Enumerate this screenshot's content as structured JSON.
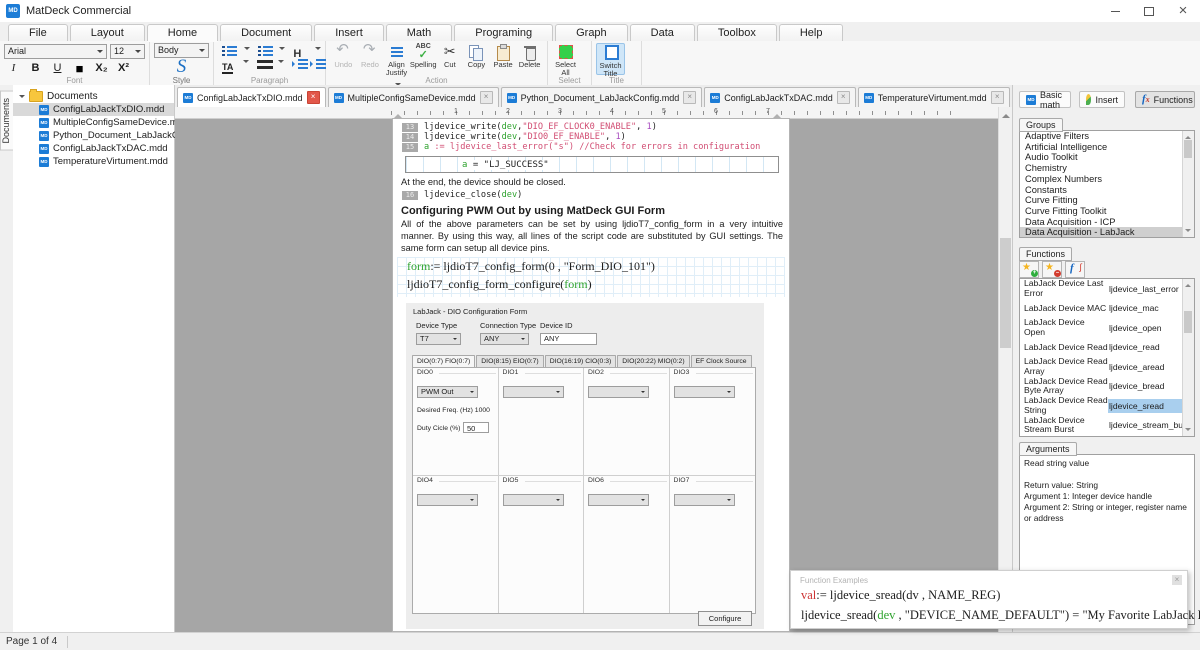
{
  "window": {
    "title": "MatDeck Commercial"
  },
  "ribbon": {
    "tabs": [
      "File",
      "Layout",
      "Home",
      "Document",
      "Insert",
      "Math",
      "Programing",
      "Graph",
      "Data",
      "Toolbox",
      "Help"
    ],
    "active_tab": "Home",
    "font": {
      "caption": "Font",
      "family": "Arial",
      "size": "12",
      "buttons": [
        "I",
        "B",
        "U",
        "■",
        "X₂",
        "X²"
      ]
    },
    "style": {
      "caption": "Style",
      "combo": "Body",
      "letter": "S",
      "label": "Style"
    },
    "paragraph": {
      "caption": "Paragraph"
    },
    "action": {
      "caption": "Action",
      "items": [
        {
          "label": "Undo",
          "icon": "undo",
          "disabled": true
        },
        {
          "label": "Redo",
          "icon": "redo",
          "disabled": true
        },
        {
          "label": "Align Justify",
          "icon": "align",
          "dropdown": true
        },
        {
          "label": "Spelling",
          "icon": "spelling"
        },
        {
          "label": "Cut",
          "icon": "cut"
        },
        {
          "label": "Copy",
          "icon": "copy"
        },
        {
          "label": "Paste",
          "icon": "paste"
        },
        {
          "label": "Delete",
          "icon": "delete"
        }
      ]
    },
    "select": {
      "caption": "Select",
      "items": [
        {
          "label": "Select All",
          "icon": "selectall"
        }
      ]
    },
    "title": {
      "caption": "Title",
      "items": [
        {
          "label": "Switch Title",
          "icon": "switchtitle",
          "active": true
        }
      ]
    }
  },
  "sidebar": {
    "strip_label": "Documents",
    "root_label": "Documents",
    "files": [
      "ConfigLabJackTxDIO.mdd",
      "MultipleConfigSameDevice.mdd",
      "Python_Document_LabJackConfi...",
      "ConfigLabJackTxDAC.mdd",
      "TemperatureVirtument.mdd"
    ],
    "selected_file": "ConfigLabJackTxDIO.mdd"
  },
  "doc_tabs": [
    {
      "label": "ConfigLabJackTxDIO.mdd",
      "active": true
    },
    {
      "label": "MultipleConfigSameDevice.mdd",
      "active": false
    },
    {
      "label": "Python_Document_LabJackConfig.mdd",
      "active": false
    },
    {
      "label": "ConfigLabJackTxDAC.mdd",
      "active": false
    },
    {
      "label": "TemperatureVirtument.mdd",
      "active": false
    }
  ],
  "ruler": {
    "numbers": [
      "1",
      "2",
      "3",
      "4",
      "5",
      "6",
      "7"
    ]
  },
  "document": {
    "code_lines": [
      {
        "num": "13",
        "segments": [
          {
            "t": "ljdevice_write(",
            "c": "k"
          },
          {
            "t": "dev",
            "c": "g"
          },
          {
            "t": ",",
            "c": "k"
          },
          {
            "t": "\"DIO_EF_CLOCK0_ENABLE\"",
            "c": "r"
          },
          {
            "t": ", ",
            "c": "k"
          },
          {
            "t": "1",
            "c": "p"
          },
          {
            "t": ")",
            "c": "k"
          }
        ]
      },
      {
        "num": "14",
        "segments": [
          {
            "t": "ljdevice_write(",
            "c": "k"
          },
          {
            "t": "dev",
            "c": "g"
          },
          {
            "t": ",",
            "c": "k"
          },
          {
            "t": "\"DIO0_EF_ENABLE\"",
            "c": "r"
          },
          {
            "t": ", ",
            "c": "k"
          },
          {
            "t": "1",
            "c": "p"
          },
          {
            "t": ")",
            "c": "k"
          }
        ]
      },
      {
        "num": "15",
        "segments": [
          {
            "t": "a",
            "c": "g"
          },
          {
            "t": " := ljdevice_last_error(\"s\") //Check for errors in configuration",
            "c": "r"
          }
        ]
      }
    ],
    "result": {
      "segments": [
        {
          "t": "a",
          "c": "g"
        },
        {
          "t": " = \"LJ_SUCCESS\"",
          "c": "k"
        }
      ]
    },
    "note": "At the end, the device should be closed.",
    "close_line": {
      "num": "16",
      "segments": [
        {
          "t": "ljdevice_close(",
          "c": "k"
        },
        {
          "t": "dev",
          "c": "g"
        },
        {
          "t": ")",
          "c": "k"
        }
      ]
    },
    "heading": "Configuring PWM Out by using MatDeck GUI Form",
    "paragraph": "All of the above parameters can be set by using ljdioT7_config_form in a very intuitive manner. By using this way, all lines of the script code are substituted by GUI settings. The same form can setup all device pins.",
    "math_lines": [
      {
        "segments": [
          {
            "t": "form",
            "c": "g"
          },
          {
            "t": ":= ljdioT7_config_form(0 , \"Form_DIO_101\")",
            "c": "k"
          }
        ]
      },
      {
        "segments": [
          {
            "t": "ljdioT7_config_form_configure(",
            "c": "k"
          },
          {
            "t": "form",
            "c": "g"
          },
          {
            "t": ")",
            "c": "k"
          }
        ]
      }
    ],
    "form": {
      "title": "LabJack - DIO Configuration Form",
      "device_type_label": "Device Type",
      "connection_type_label": "Connection Type",
      "device_id_label": "Device ID",
      "device_type_value": "T7",
      "connection_type_value": "ANY",
      "device_id_value": "ANY",
      "tabs": [
        "DIO(0:7) FIO(0:7)",
        "DIO(8:15) EIO(0:7)",
        "DIO(16:19) CIO(0:3)",
        "DIO(20:22) MIO(0:2)",
        "EF Clock Source"
      ],
      "active_tab": "DIO(0:7) FIO(0:7)",
      "cells": [
        {
          "label": "DIO0",
          "combo": "PWM Out",
          "freq_label": "Desired Freq. (Hz) 1000",
          "duty_label": "Duty Cicle (%)",
          "duty_value": "50"
        },
        {
          "label": "DIO1",
          "combo": ""
        },
        {
          "label": "DIO2",
          "combo": ""
        },
        {
          "label": "DIO3",
          "combo": ""
        },
        {
          "label": "DIO4",
          "combo": ""
        },
        {
          "label": "DIO5",
          "combo": ""
        },
        {
          "label": "DIO6",
          "combo": ""
        },
        {
          "label": "DIO7",
          "combo": ""
        }
      ],
      "configure_label": "Configure"
    }
  },
  "right_panel": {
    "tabs": [
      {
        "label": "Basic math",
        "icon": "md",
        "active": false
      },
      {
        "label": "Insert",
        "icon": "insert",
        "active": false
      },
      {
        "label": "Functions",
        "icon": "fx",
        "active": true
      }
    ],
    "groups": {
      "tab_label": "Groups",
      "items": [
        "Adaptive Filters",
        "Artificial Intelligence",
        "Audio Toolkit",
        "Chemistry",
        "Complex Numbers",
        "Constants",
        "Curve Fitting",
        "Curve Fitting Toolkit",
        "Data Acquisition - ICP",
        "Data Acquisition - LabJack"
      ],
      "selected": "Data Acquisition - LabJack"
    },
    "functions": {
      "tab_label": "Functions",
      "rows": [
        {
          "name": "LabJack Device Last Error",
          "id": "ljdevice_last_error",
          "selected": false
        },
        {
          "name": "LabJack Device MAC",
          "id": "ljdevice_mac",
          "selected": false
        },
        {
          "name": "LabJack Device Open",
          "id": "ljdevice_open",
          "selected": false
        },
        {
          "name": "LabJack Device Read",
          "id": "ljdevice_read",
          "selected": false
        },
        {
          "name": "LabJack Device Read Array",
          "id": "ljdevice_aread",
          "selected": false
        },
        {
          "name": "LabJack Device Read Byte Array",
          "id": "ljdevice_bread",
          "selected": false
        },
        {
          "name": "LabJack Device Read String",
          "id": "ljdevice_sread",
          "selected": true
        },
        {
          "name": "LabJack Device Stream Burst",
          "id": "ljdevice_stream_burst",
          "selected": false
        }
      ]
    },
    "arguments": {
      "tab_label": "Arguments",
      "text_lines": [
        "Read string value",
        "",
        "Return value: String",
        "Argument 1: Integer device handle",
        "Argument 2: String or integer, register name or address"
      ]
    }
  },
  "examples_popup": {
    "title": "Function Examples",
    "lines": [
      {
        "segments": [
          {
            "t": "val",
            "c": "r"
          },
          {
            "t": ":= ljdevice_sread(dv , NAME_REG)",
            "c": "k"
          }
        ]
      },
      {
        "segments": [
          {
            "t": "ljdevice_sread(",
            "c": "k"
          },
          {
            "t": "dev",
            "c": "g"
          },
          {
            "t": " , \"DEVICE_NAME_DEFAULT\") = \"My Favorite LabJack Device\"",
            "c": "k"
          }
        ]
      }
    ]
  },
  "status_bar": {
    "text": "Page 1 of 4"
  }
}
